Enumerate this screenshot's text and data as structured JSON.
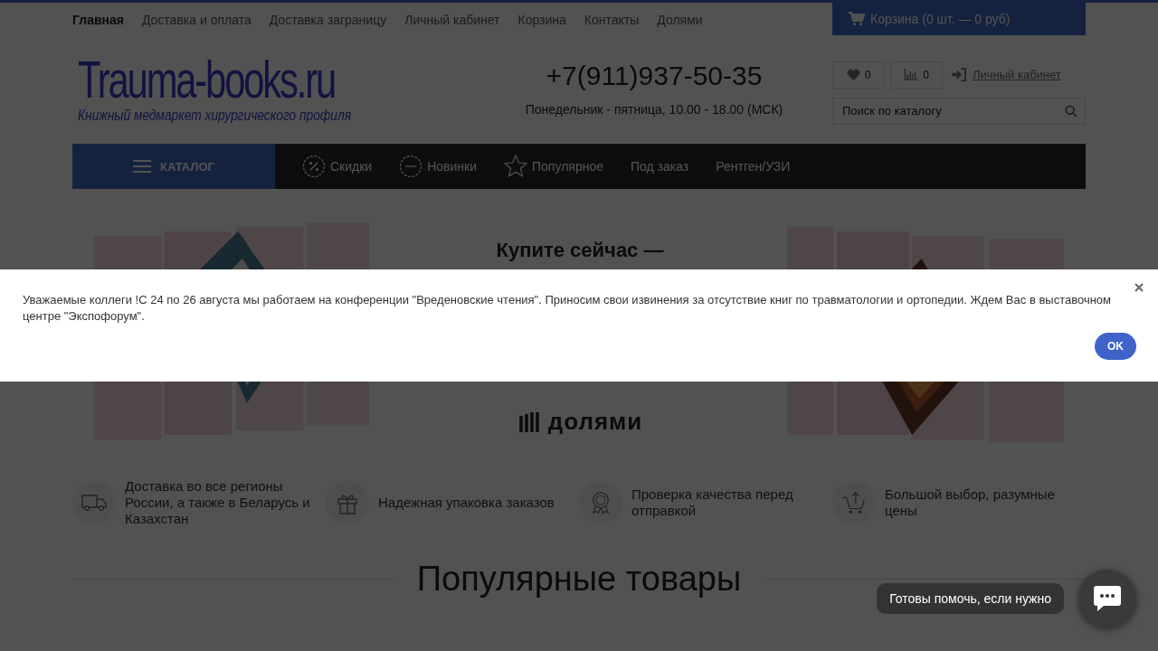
{
  "top_menu": [
    {
      "label": "Главная",
      "selected": true
    },
    {
      "label": "Доставка и оплата",
      "selected": false
    },
    {
      "label": "Доставка заграницу",
      "selected": false
    },
    {
      "label": "Личный кабинет",
      "selected": false
    },
    {
      "label": "Корзина",
      "selected": false
    },
    {
      "label": "Контакты",
      "selected": false
    },
    {
      "label": "Долями",
      "selected": false
    }
  ],
  "cart_button": "Корзина (0 шт. — 0 руб)",
  "logo": {
    "title": "Trauma-books.ru",
    "tagline": "Книжный медмаркет хирургического профиля"
  },
  "phone": "+7(911)937-50-35",
  "hours": "Понедельник - пятница, 10.00 - 18.00 (МСК)",
  "favorites_count": "0",
  "compare_count": "0",
  "account_link": "Личный кабинет",
  "search": {
    "placeholder": "Поиск по каталогу"
  },
  "catalog_button": "КАТАЛОГ",
  "nav": [
    {
      "label": "Скидки",
      "kind": "discount"
    },
    {
      "label": "Новинки",
      "kind": "new"
    },
    {
      "label": "Популярное",
      "kind": "star"
    },
    {
      "label": "Под заказ",
      "kind": "plain"
    },
    {
      "label": "Рентген/УЗИ",
      "kind": "plain"
    }
  ],
  "banner": {
    "headline": "Купите сейчас —",
    "brand": "долями"
  },
  "features": [
    {
      "text": "Доставка во все регионы России, а также в Беларусь и Казахстан",
      "kind": "truck"
    },
    {
      "text": "Надежная упаковка заказов",
      "kind": "gift"
    },
    {
      "text": "Проверка качества перед отправкой",
      "kind": "medal"
    },
    {
      "text": "Большой выбор, разумные цены",
      "kind": "cart"
    }
  ],
  "section_title": "Популярные товары",
  "notice": {
    "text": "Уважаемые коллеги !С 24 по 26 августа мы работаем на конференции \"Вреденовские чтения\". Приносим свои извинения за отсутствие книг по травматологии и ортопедии. Ждем Вас в выставочном центре \"Экспофорум\".",
    "button": "OK"
  },
  "chat": {
    "prompt": "Готовы помочь, если нужно"
  }
}
